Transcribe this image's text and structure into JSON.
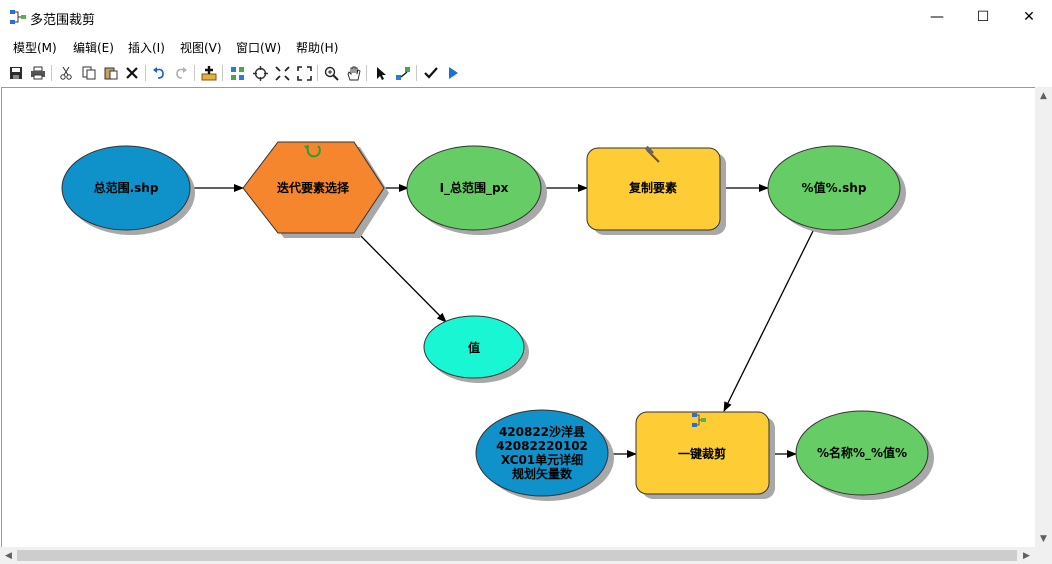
{
  "window": {
    "title": "多范围裁剪",
    "minimize": "—",
    "maximize": "☐",
    "close": "✕"
  },
  "menu": [
    "模型(M)",
    "编辑(E)",
    "插入(I)",
    "视图(V)",
    "窗口(W)",
    "帮助(H)"
  ],
  "toolbar": {
    "tools": [
      "save-icon",
      "print-icon",
      "cut-icon",
      "copy-icon",
      "paste-icon",
      "delete-icon",
      "undo-icon",
      "redo-icon",
      "add-data-icon",
      "auto-layout-icon",
      "full-extent-icon",
      "zoom-in-fixed-icon",
      "zoom-out-fixed-icon",
      "zoom-in-icon",
      "pan-icon",
      "select-icon",
      "connect-icon",
      "validate-icon",
      "run-icon"
    ]
  },
  "diagram": {
    "nodes": {
      "input_shp": "总范围.shp",
      "iterator": "迭代要素选择",
      "iter_output": "I_总范围_px",
      "value": "值",
      "copy_tool": "复制要素",
      "copy_output": "%值%.shp",
      "clip_input": [
        "420822沙洋县",
        "42082220102",
        "XC01单元详细",
        "规划矢量数"
      ],
      "clip_tool": "一键裁剪",
      "clip_output": "%名称%_%值%"
    },
    "colors": {
      "input_blue": "#0f91c9",
      "tool_yellow": "#fecd35",
      "output_green": "#66cc66",
      "iterator_orange": "#f5862e",
      "value_cyan": "#19f6d3"
    }
  }
}
